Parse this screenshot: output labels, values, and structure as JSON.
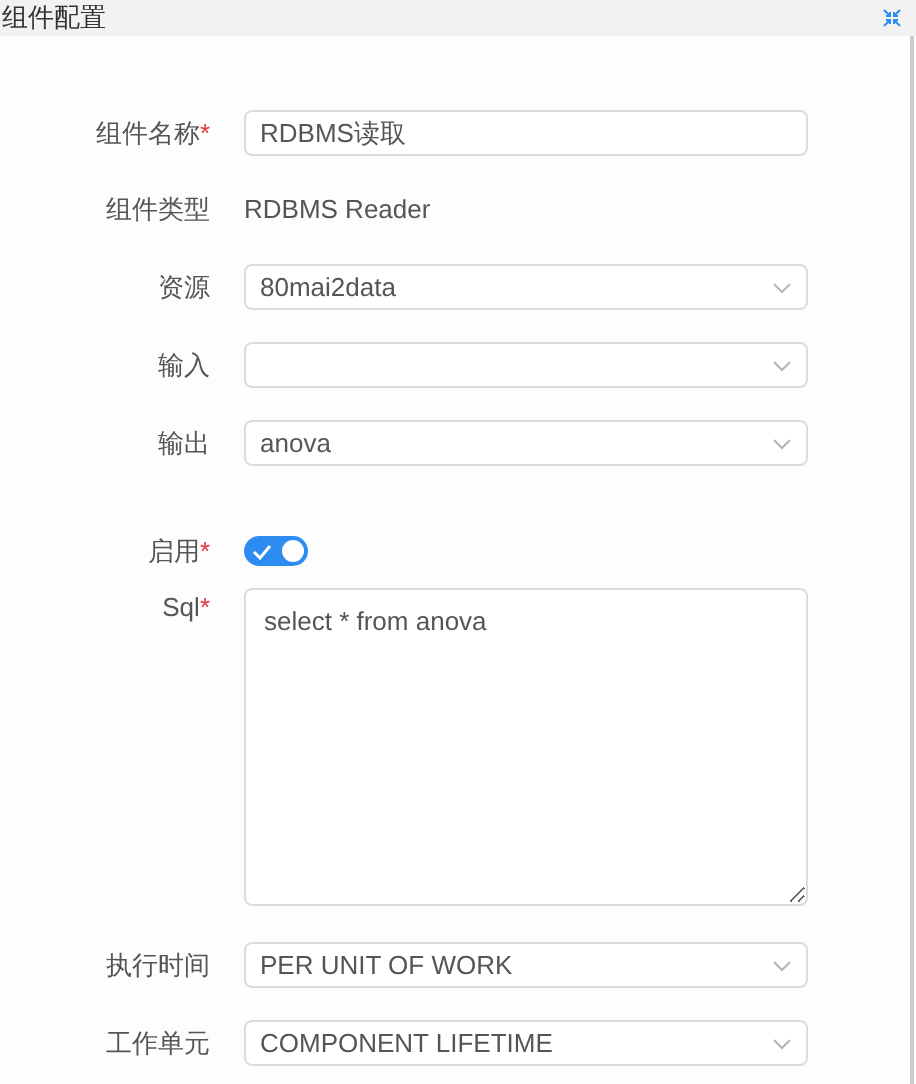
{
  "header": {
    "title": "组件配置"
  },
  "fields": [
    {
      "kind": "text",
      "label": "组件名称",
      "required_mark": "*",
      "value": "RDBMS读取"
    },
    {
      "kind": "static",
      "label": "组件类型",
      "value": "RDBMS Reader"
    },
    {
      "kind": "select",
      "label": "资源",
      "value": "80mai2data"
    },
    {
      "kind": "select",
      "label": "输入"
    },
    {
      "kind": "select",
      "label": "输出",
      "value": "anova"
    },
    {
      "kind": "toggle",
      "label": "启用",
      "required_mark": "*",
      "on": true
    },
    {
      "kind": "textarea",
      "label": "Sql",
      "required_mark": "*",
      "value": "select * from anova"
    },
    {
      "kind": "select",
      "label": "执行时间",
      "value": "PER UNIT OF WORK"
    },
    {
      "kind": "select",
      "label": "工作单元",
      "value": "COMPONENT LIFETIME"
    }
  ]
}
